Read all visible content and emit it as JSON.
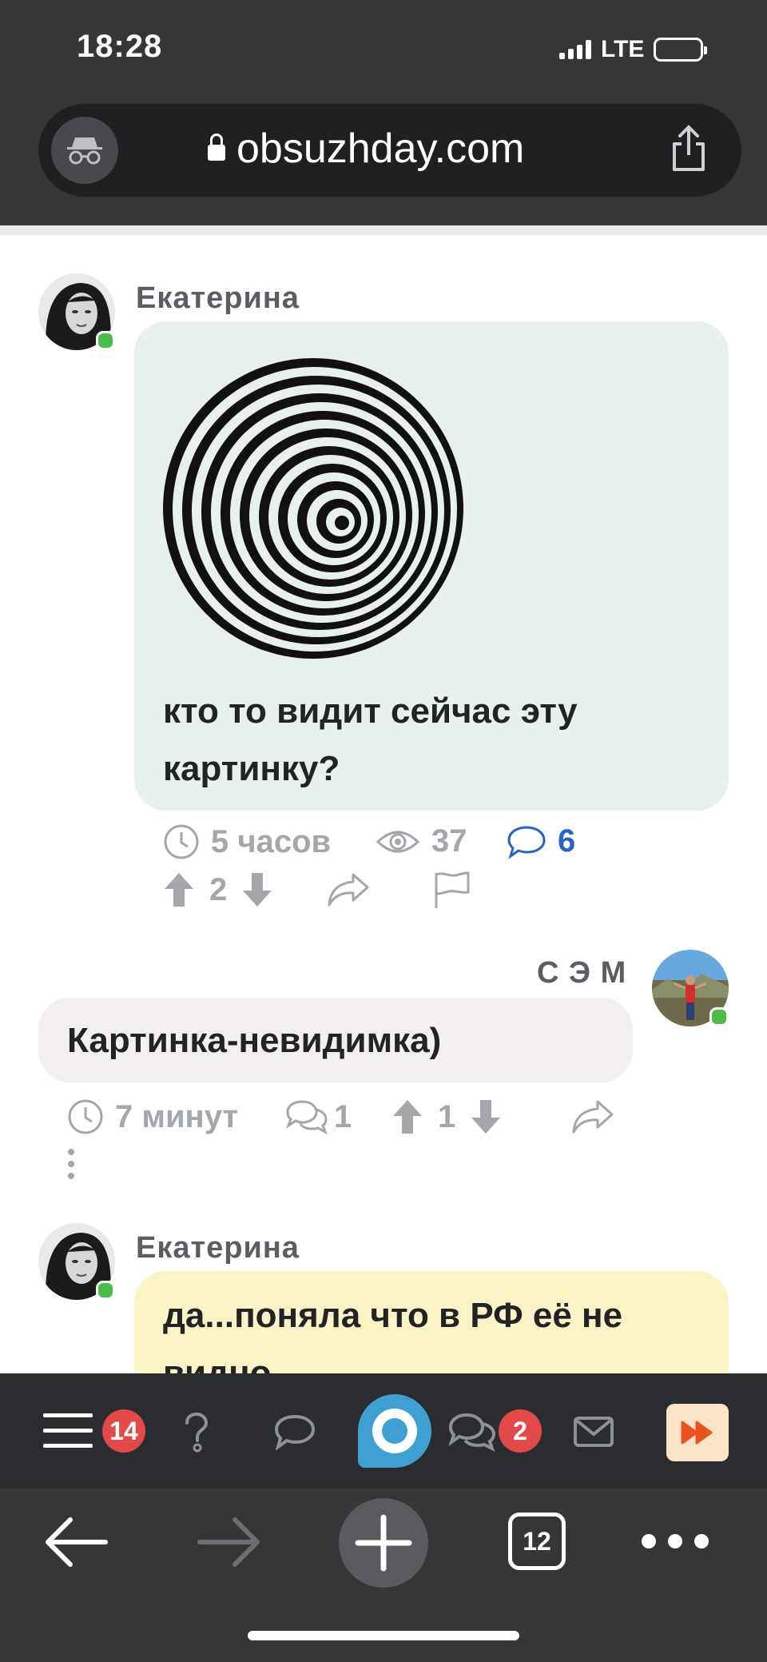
{
  "status_bar": {
    "time": "18:28",
    "network": "LTE"
  },
  "browser": {
    "url": "obsuzhday.com",
    "tabs_count": "12"
  },
  "comments": [
    {
      "author": "Екатерина",
      "text_line1": "кто то видит сейчас эту",
      "text_line2": "картинку?",
      "time": "5 часов",
      "views": "37",
      "comments": "6",
      "rating": "2",
      "bubble_color": "#e8f0ec"
    },
    {
      "author": "С Э М",
      "text": "Картинка-невидимка)",
      "time": "7 минут",
      "replies": "1",
      "rating": "1",
      "bubble_color": "#f2efee"
    },
    {
      "author": "Екатерина",
      "text_line1": "да...поняла что в РФ её не",
      "text_line2": "видно",
      "bubble_color": "#fbf2c5"
    }
  ],
  "site_nav": {
    "menu_badge": "14",
    "chats_badge": "2"
  },
  "colors": {
    "accent_blue": "#2b63c2",
    "logo_blue": "#3e9fd3",
    "forward_button_bg": "#fbe3c8",
    "forward_button_fg": "#e8531f"
  }
}
